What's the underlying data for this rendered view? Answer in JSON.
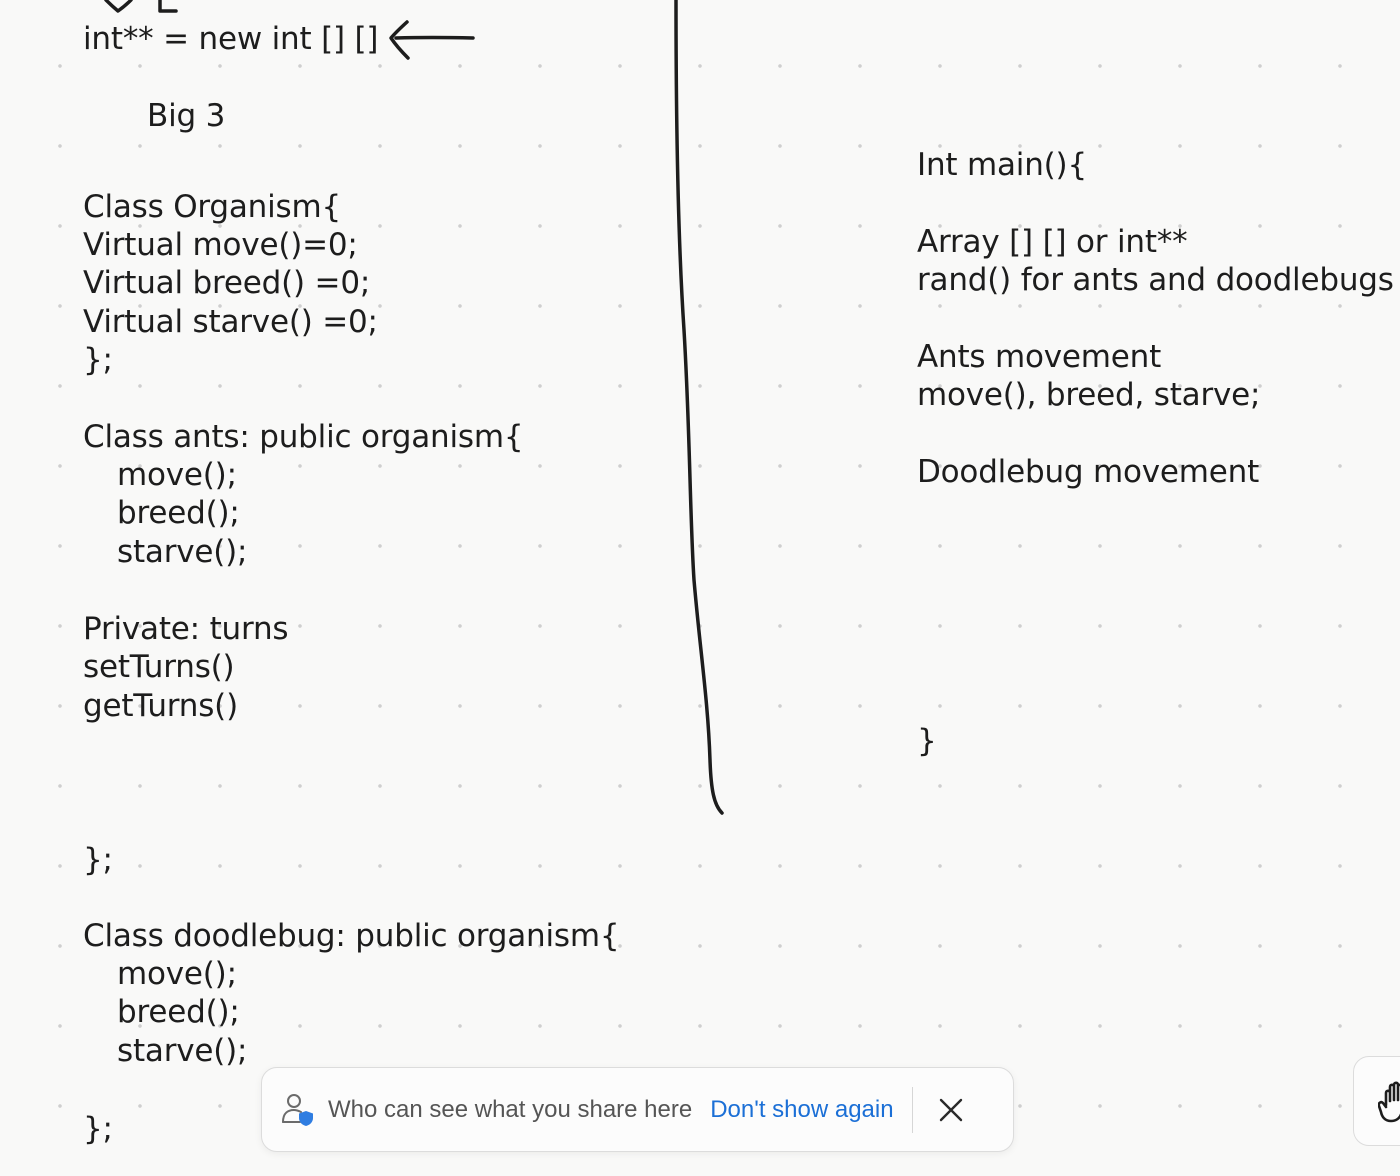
{
  "left_notes": [
    {
      "text": "int** = new int [] []"
    },
    {
      "text": "Big 3"
    },
    {
      "text": "Class Organism{"
    },
    {
      "text": "Virtual move()=0;"
    },
    {
      "text": "Virtual breed() =0;"
    },
    {
      "text": "Virtual starve() =0;"
    },
    {
      "text": "};"
    },
    {
      "text": "Class ants: public organism{"
    },
    {
      "text": "move();"
    },
    {
      "text": "breed();"
    },
    {
      "text": "starve();"
    },
    {
      "text": "Private: turns"
    },
    {
      "text": "setTurns()"
    },
    {
      "text": "getTurns()"
    },
    {
      "text": "};"
    },
    {
      "text": "Class doodlebug: public organism{"
    },
    {
      "text": "move();"
    },
    {
      "text": "breed();"
    },
    {
      "text": "starve();"
    },
    {
      "text": "};"
    }
  ],
  "right_notes": [
    {
      "text": "Int main(){"
    },
    {
      "text": "Array [] [] or int**"
    },
    {
      "text": "rand() for ants and doodlebugs"
    },
    {
      "text": "Ants movement"
    },
    {
      "text": "move(), breed, starve;"
    },
    {
      "text": "Doodlebug movement"
    },
    {
      "text": "}"
    }
  ],
  "toast": {
    "message": "Who can see what you share here",
    "dont_show_label": "Don't show again",
    "icon": "person-shield-icon",
    "close_icon": "close-icon"
  },
  "toolbar": {
    "hand_tool_icon": "hand-icon"
  },
  "colors": {
    "background": "#f9f9f8",
    "ink": "#1d1d1d",
    "link": "#1b6fd6"
  }
}
